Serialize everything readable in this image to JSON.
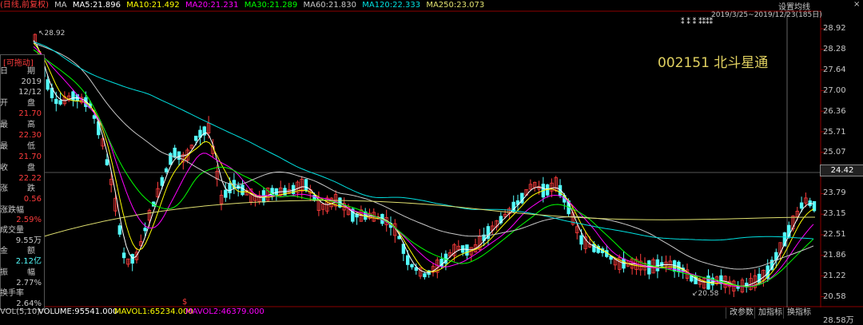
{
  "topbar": {
    "period_label": "(日线,前复权)",
    "ma": "MA",
    "ma5": "MA5:21.896",
    "ma10": "MA10:21.492",
    "ma20": "MA20:21.231",
    "ma30": "MA30:21.289",
    "ma60": "MA60:21.830",
    "ma120": "MA120:22.333",
    "ma250": "MA250:23.073",
    "settings": "设置均线",
    "date_range": "2019/3/25~2019/12/23(185日)"
  },
  "colors": {
    "ma5": "#ffffff",
    "ma10": "#ffff00",
    "ma20": "#ff00ff",
    "ma30": "#00ff00",
    "ma60": "#c8c8c8",
    "ma120": "#00e0e0",
    "ma250": "#e0e070",
    "up": "#ff3c3c",
    "down": "#54fcfc"
  },
  "stock_label": "002151 北斗星通",
  "panel": {
    "title": "[可拖动]",
    "date_label": "日",
    "date_label2": "期",
    "year": "2019",
    "month_day": "12/12",
    "open_label": "开",
    "open_label2": "盘",
    "open": "21.70",
    "high_label": "最",
    "high_label2": "高",
    "high": "22.30",
    "low_label": "最",
    "low_label2": "低",
    "low": "21.70",
    "close_label": "收",
    "close_label2": "盘",
    "close": "22.22",
    "change_label": "涨",
    "change_label2": "跌",
    "change": "0.56",
    "change_pct_label": "涨跌幅",
    "change_pct": "2.59%",
    "volume_label": "成交量",
    "volume": "9.55万",
    "amount_label": "金",
    "amount_label2": "额",
    "amount": "2.12亿",
    "amplitude_label": "振",
    "amplitude_label2": "幅",
    "amplitude": "2.77%",
    "turnover_label": "换手率",
    "turnover": "2.64%"
  },
  "yaxis": [
    "28.92",
    "28.28",
    "27.64",
    "27.00",
    "26.36",
    "25.71",
    "25.07",
    "24.42",
    "23.79",
    "23.15",
    "22.51",
    "21.86",
    "21.22",
    "20.58"
  ],
  "current_price": "24.42",
  "high_marker": "28.92",
  "low_marker": "20.58",
  "markers": "⁑  ⁑  ⁑  ⁑⁑⁑⁑",
  "bottom": {
    "vol_prefix": "VOL(5,10)",
    "volume": "VOLUME:95541.000",
    "mavol1": "MAVOL1:65234.000",
    "mavol2": "MAVOL2:46379.000",
    "vol_axis": "28.58万",
    "btn_params": "改参数",
    "btn_add": "加指标",
    "btn_swap": "换指标",
    "s_marker": "$"
  }
}
